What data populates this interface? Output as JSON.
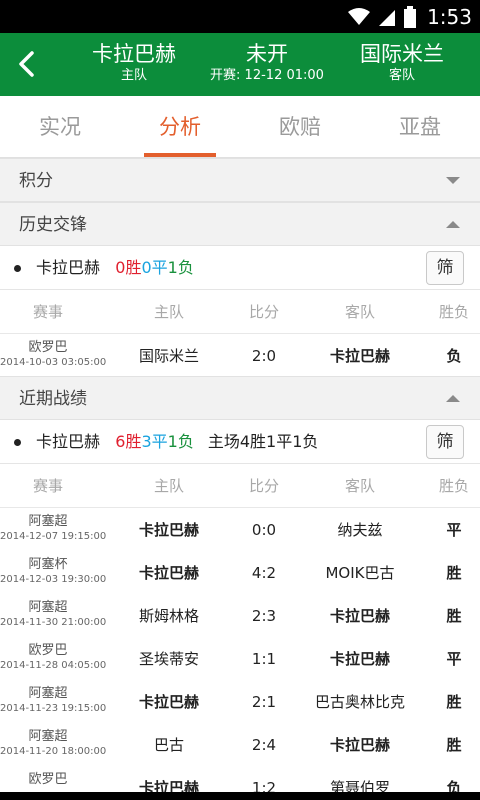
{
  "status_bar": {
    "time": "1:53"
  },
  "header": {
    "home_team": "卡拉巴赫",
    "home_role": "主队",
    "status": "未开",
    "kickoff": "开赛: 12-12 01:00",
    "away_team": "国际米兰",
    "away_role": "客队"
  },
  "tabs": [
    "实况",
    "分析",
    "欧赔",
    "亚盘"
  ],
  "sections": {
    "standings": "积分",
    "h2h": "历史交锋",
    "recent": "近期战绩"
  },
  "h2h_summary": {
    "team": "卡拉巴赫",
    "wins": "0胜",
    "draws": "0平",
    "losses": "1负",
    "filter": "筛"
  },
  "recent_summary": {
    "team": "卡拉巴赫",
    "wins": "6胜",
    "draws": "3平",
    "losses": "1负",
    "home_record": "主场4胜1平1负",
    "filter": "筛"
  },
  "table_headers": [
    "赛事",
    "主队",
    "比分",
    "客队",
    "胜负"
  ],
  "h2h_rows": [
    {
      "comp": "欧罗巴",
      "date": "2014-10-03 03:05:00",
      "home": "国际米兰",
      "score": "2:0",
      "away": "卡拉巴赫",
      "result": "负"
    }
  ],
  "recent_rows": [
    {
      "comp": "阿塞超",
      "date": "2014-12-07 19:15:00",
      "home": "卡拉巴赫",
      "score": "0:0",
      "away": "纳夫兹",
      "result": "平"
    },
    {
      "comp": "阿塞杯",
      "date": "2014-12-03 19:30:00",
      "home": "卡拉巴赫",
      "score": "4:2",
      "away": "MOIK巴古",
      "result": "胜"
    },
    {
      "comp": "阿塞超",
      "date": "2014-11-30 21:00:00",
      "home": "斯姆林格",
      "score": "2:3",
      "away": "卡拉巴赫",
      "result": "胜"
    },
    {
      "comp": "欧罗巴",
      "date": "2014-11-28 04:05:00",
      "home": "圣埃蒂安",
      "score": "1:1",
      "away": "卡拉巴赫",
      "result": "平"
    },
    {
      "comp": "阿塞超",
      "date": "2014-11-23 19:15:00",
      "home": "卡拉巴赫",
      "score": "2:1",
      "away": "巴古奥林比克",
      "result": "胜"
    },
    {
      "comp": "阿塞超",
      "date": "2014-11-20 18:00:00",
      "home": "巴古",
      "score": "2:4",
      "away": "卡拉巴赫",
      "result": "胜"
    },
    {
      "comp": "欧罗巴",
      "date": "",
      "home": "卡拉巴赫",
      "score": "1:2",
      "away": "第聂伯罗",
      "result": "负"
    }
  ],
  "colors": {
    "header_green": "#0c8d3b",
    "tab_active": "#e35f2d",
    "win": "#e0202f",
    "draw": "#1aa3df",
    "loss": "#19913d"
  }
}
